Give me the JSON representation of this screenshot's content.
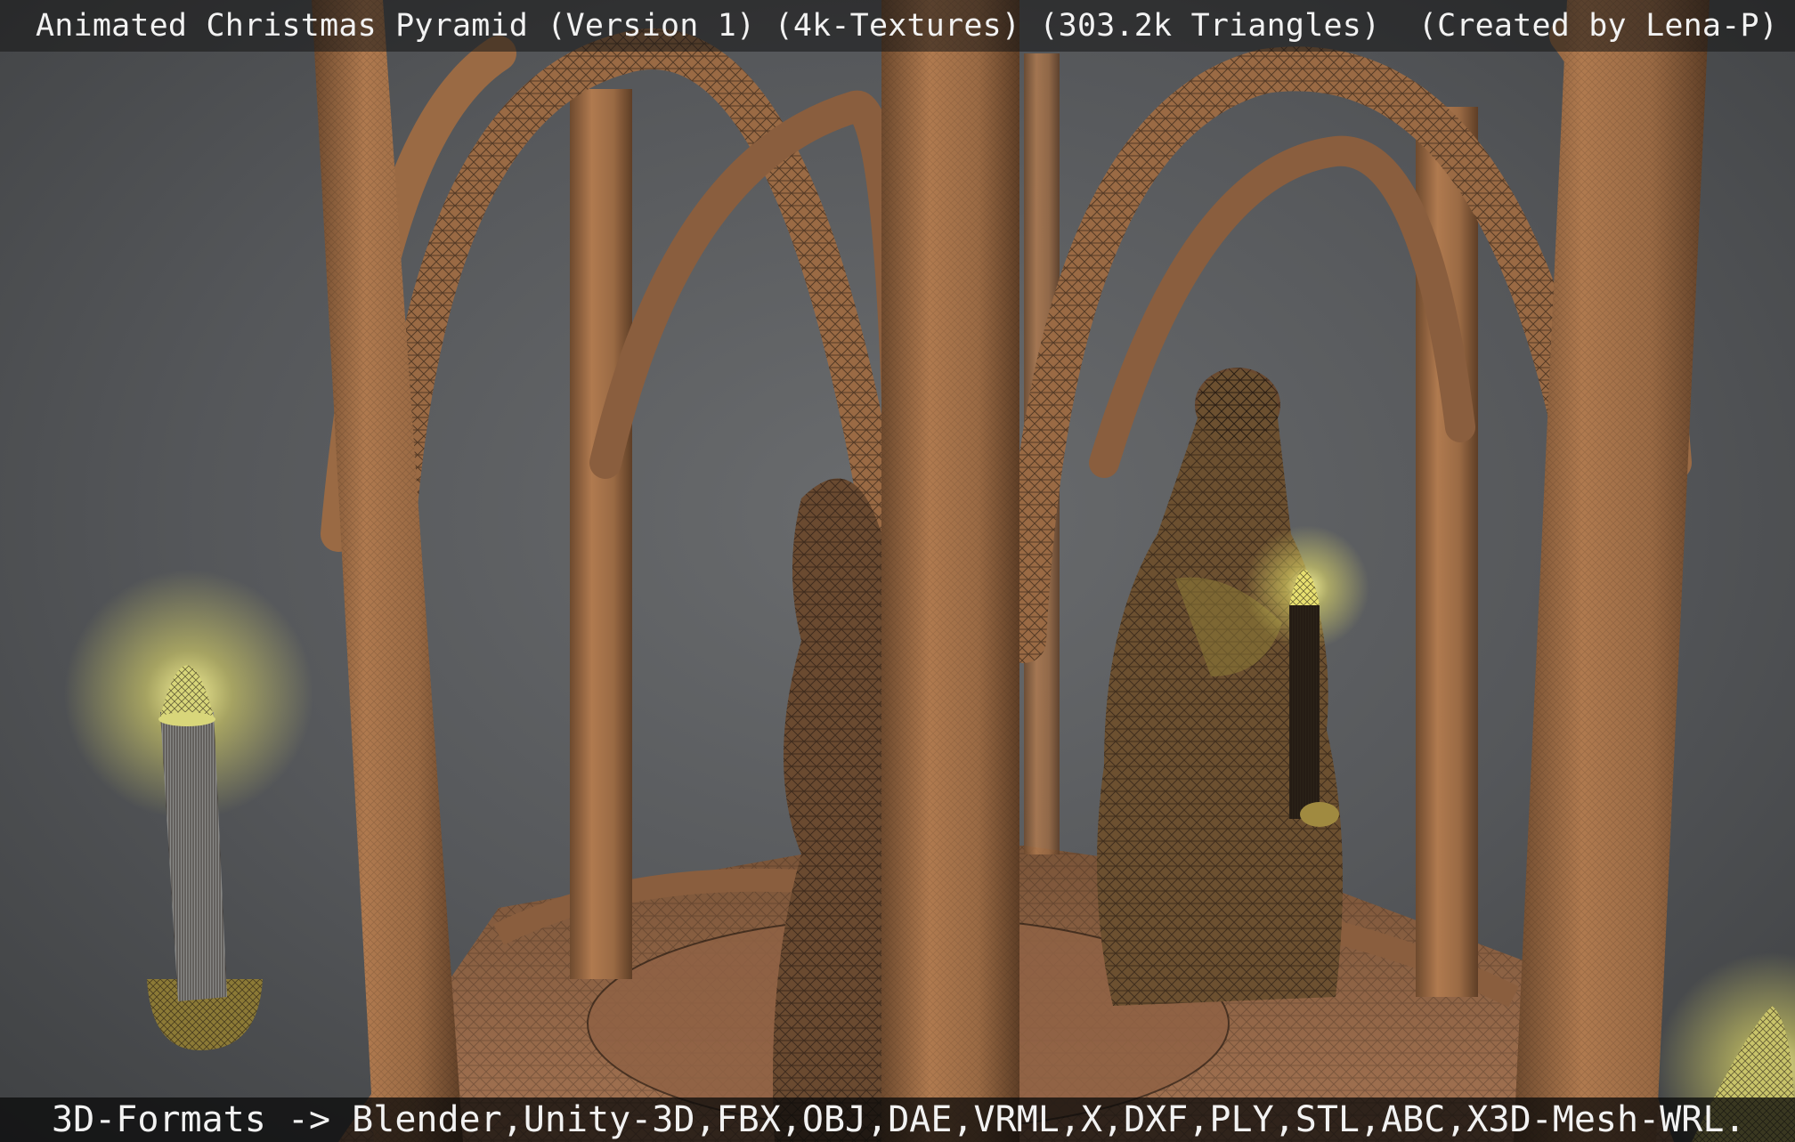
{
  "title": "Animated Christmas Pyramid (Version 1) (4k-Textures) (303.2k Triangles)  (Created by Lena-P)",
  "formats": "3D-Formats -> Blender,Unity-3D,FBX,OBJ,DAE,VRML,X,DXF,PLY,STL,ABC,X3D-Mesh-WRL.",
  "colors": {
    "wood": "#9a6a44",
    "wood_dark": "#6e4a2e",
    "wireframe": "#1a120c",
    "candle_glow": "#f4f08a",
    "background": "#55575a"
  }
}
